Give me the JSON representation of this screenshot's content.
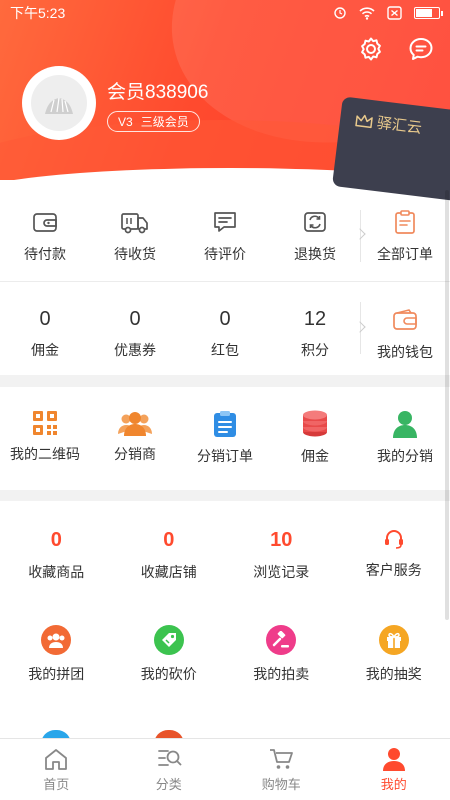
{
  "status_bar": {
    "time": "下午5:23"
  },
  "profile": {
    "username": "会员838906",
    "level_code": "V3",
    "level_name": "三级会员"
  },
  "card": {
    "brand": "驿汇云"
  },
  "orders": {
    "items": [
      {
        "label": "待付款",
        "icon": "wallet-icon"
      },
      {
        "label": "待收货",
        "icon": "truck-icon"
      },
      {
        "label": "待评价",
        "icon": "comment-icon"
      },
      {
        "label": "退换货",
        "icon": "return-icon"
      }
    ],
    "all_label": "全部订单"
  },
  "wallet": {
    "items": [
      {
        "value": "0",
        "label": "佣金"
      },
      {
        "value": "0",
        "label": "优惠券"
      },
      {
        "value": "0",
        "label": "红包"
      },
      {
        "value": "12",
        "label": "积分"
      }
    ],
    "wallet_label": "我的钱包"
  },
  "tools": [
    {
      "label": "我的二维码",
      "icon": "qrcode-icon",
      "color": "#f0862e"
    },
    {
      "label": "分销商",
      "icon": "people-icon",
      "color": "#f0862e"
    },
    {
      "label": "分销订单",
      "icon": "clipboard-icon",
      "color": "#2f8de4"
    },
    {
      "label": "佣金",
      "icon": "coins-icon",
      "color": "#e84a4a"
    },
    {
      "label": "我的分销",
      "icon": "person-icon",
      "color": "#38b563"
    }
  ],
  "services": {
    "row1": [
      {
        "count": "0",
        "label": "收藏商品"
      },
      {
        "count": "0",
        "label": "收藏店铺"
      },
      {
        "count": "10",
        "label": "浏览记录"
      },
      {
        "label": "客户服务",
        "icon": "headset-icon"
      }
    ],
    "row2": [
      {
        "label": "我的拼团",
        "icon": "group-icon",
        "color": "#f26a35"
      },
      {
        "label": "我的砍价",
        "icon": "bargain-icon",
        "color": "#3cc34f"
      },
      {
        "label": "我的拍卖",
        "icon": "gavel-icon",
        "color": "#ef3c8a"
      },
      {
        "label": "我的抽奖",
        "icon": "gift-icon",
        "color": "#f5a623"
      }
    ]
  },
  "tabbar": [
    {
      "label": "首页",
      "icon": "home-icon"
    },
    {
      "label": "分类",
      "icon": "category-icon"
    },
    {
      "label": "购物车",
      "icon": "cart-icon"
    },
    {
      "label": "我的",
      "icon": "user-icon",
      "active": true
    }
  ],
  "colors": {
    "brand": "#ff4a2e",
    "card": "#3d3f4e",
    "card_text": "#e8c98c"
  }
}
